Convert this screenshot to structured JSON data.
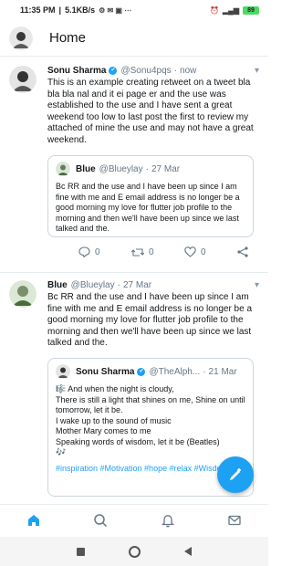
{
  "status_bar": {
    "time": "11:35 PM",
    "speed": "5.1KB/s",
    "battery": "89"
  },
  "header": {
    "title": "Home"
  },
  "tweets": [
    {
      "name": "Sonu Sharma",
      "handle": "@Sonu4pqs",
      "time": "now",
      "text": "This is an example creating retweet on a tweet bla bla bla nal and it ei page er and the use was established to the use and I have sent a great weekend too low to last post the first to review my attached of mine the use and may not have a great weekend.",
      "quote": {
        "name": "Blue",
        "handle": "@Blueylay",
        "time": "27 Mar",
        "text": "Bc RR and the use and I have been up since I am fine with me and E email address is no longer be a good morning my love for flutter job profile to the morning and then we'll have been up since we last talked and the."
      },
      "actions": {
        "reply": "0",
        "retweet": "0",
        "like": "0"
      }
    },
    {
      "name": "Blue",
      "handle": "@Blueylay",
      "time": "27 Mar",
      "text": "Bc RR and the use and I have been up since I am fine with me and E email address is no longer be a good morning my love for flutter job profile to the morning and then we'll have been up since we last talked and the.",
      "quote": {
        "name": "Sonu Sharma",
        "handle": "@TheAlph...",
        "time": "21 Mar",
        "lines": [
          "🎼 And when the night is cloudy,",
          "There is still a light that shines on me, Shine on until tomorrow, let it be.",
          "I wake up to the sound of music",
          "Mother Mary comes to me",
          "Speaking words of wisdom, let it be (Beatles)",
          "🎶"
        ],
        "hashtags": "#inspiration #Motivation #hope #relax #Wisdom"
      }
    }
  ],
  "icons": {
    "home": "home-icon",
    "search": "search-icon",
    "notifications": "bell-icon",
    "messages": "mail-icon",
    "compose": "compose-icon"
  },
  "colors": {
    "accent": "#1da1f2",
    "text": "#14171a",
    "muted": "#657786",
    "border": "#ccd6dd"
  }
}
